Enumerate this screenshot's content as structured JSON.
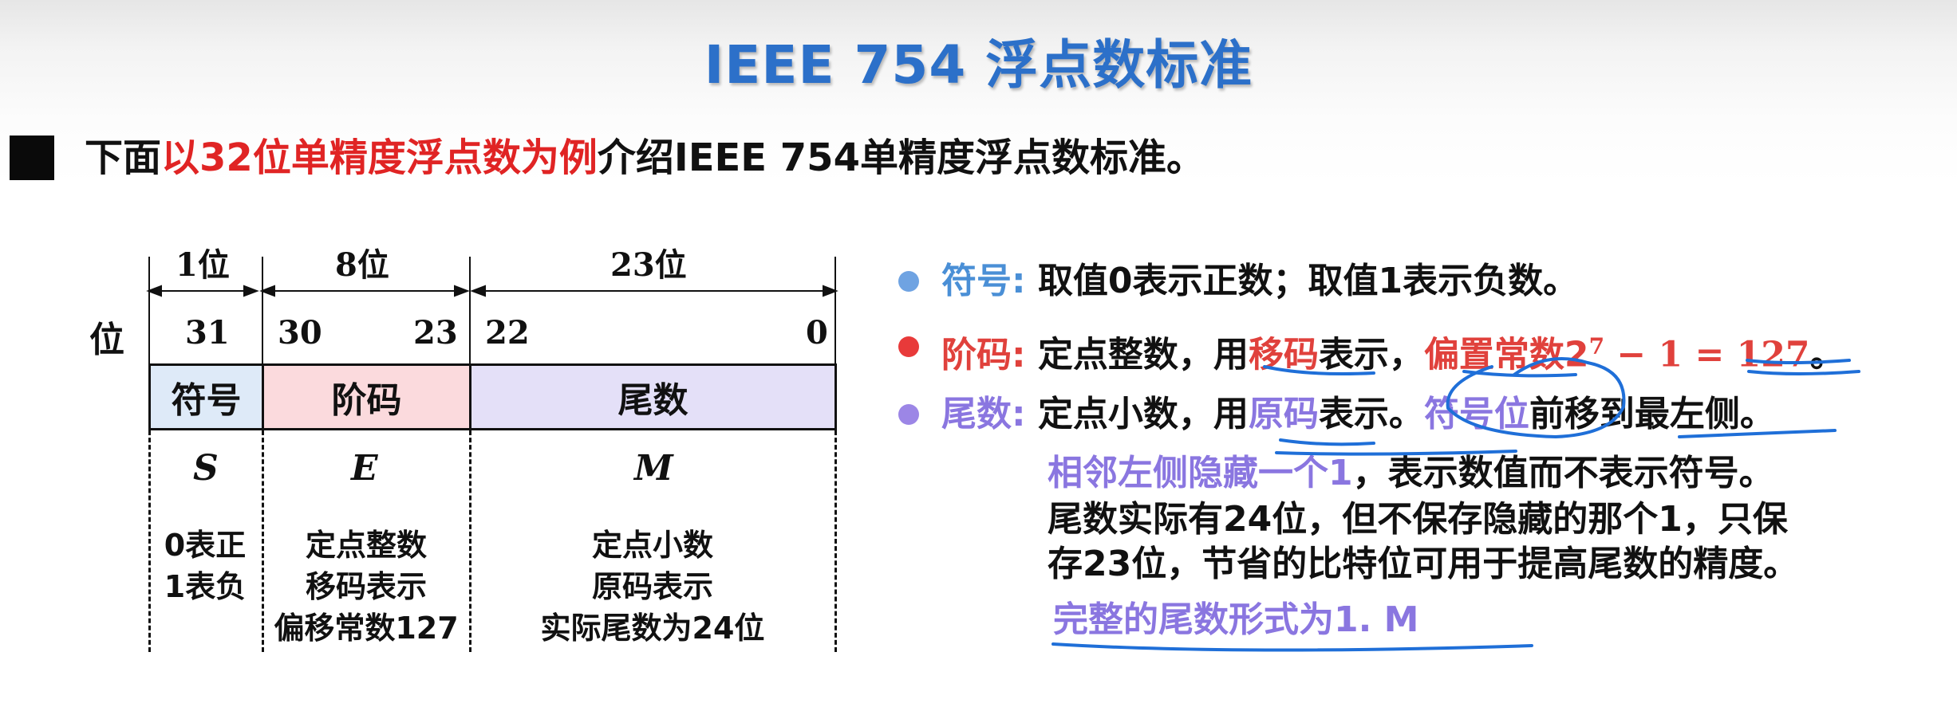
{
  "title": "IEEE 754 浮点数标准",
  "intro": {
    "prefix": "下面",
    "highlight": "以32位单精度浮点数为例",
    "suffix": "介绍IEEE 754单精度浮点数标准。"
  },
  "diagram": {
    "row_label": "位",
    "bit_counts": [
      "1位",
      "8位",
      "23位"
    ],
    "bit_positions": {
      "sign": "31",
      "exp_high": "30",
      "exp_low": "23",
      "mant_high": "22",
      "mant_low": "0"
    },
    "fields": [
      "符号",
      "阶码",
      "尾数"
    ],
    "symbols": [
      "S",
      "E",
      "M"
    ],
    "desc_sign": [
      "0表正",
      "1表负"
    ],
    "desc_exp": [
      "定点整数",
      "移码表示",
      "偏移常数127"
    ],
    "desc_mant": [
      "定点小数",
      "原码表示",
      "实际尾数为24位"
    ]
  },
  "items": {
    "sign": {
      "key": "符号:",
      "text": "取值0表示正数；取值1表示负数。"
    },
    "exp": {
      "key": "阶码:",
      "t1": "定点整数，用",
      "hl": "移码",
      "t2": "表示，",
      "bias": "偏置常数2",
      "sup": "7",
      "eq": " − 1 = 127",
      "end": "。"
    },
    "mant": {
      "key": "尾数:",
      "t1": "定点小数，用",
      "hl": "原码",
      "t2": "表示。",
      "hl2": "符号位",
      "t3": "前移到最左侧。",
      "l2_hl": "相邻左侧隐藏一个1",
      "l2": "，表示数值而不表示符号。",
      "l3": "尾数实际有24位，但不保存隐藏的那个1，只保",
      "l4": "存23位，节省的比特位可用于提高尾数的精度。",
      "l5": "完整的尾数形式为1. M"
    }
  },
  "colors": {
    "title": "#2c70c9",
    "intro_red": "#e02424",
    "sign_field": "#deeaf8",
    "exp_field": "#fbdadd",
    "mant_field": "#e4e0f8",
    "dot_sign": "#6fa3e2",
    "dot_exp": "#e83a3a",
    "dot_mant": "#9c86e6",
    "annotation": "#1f6fd8"
  }
}
